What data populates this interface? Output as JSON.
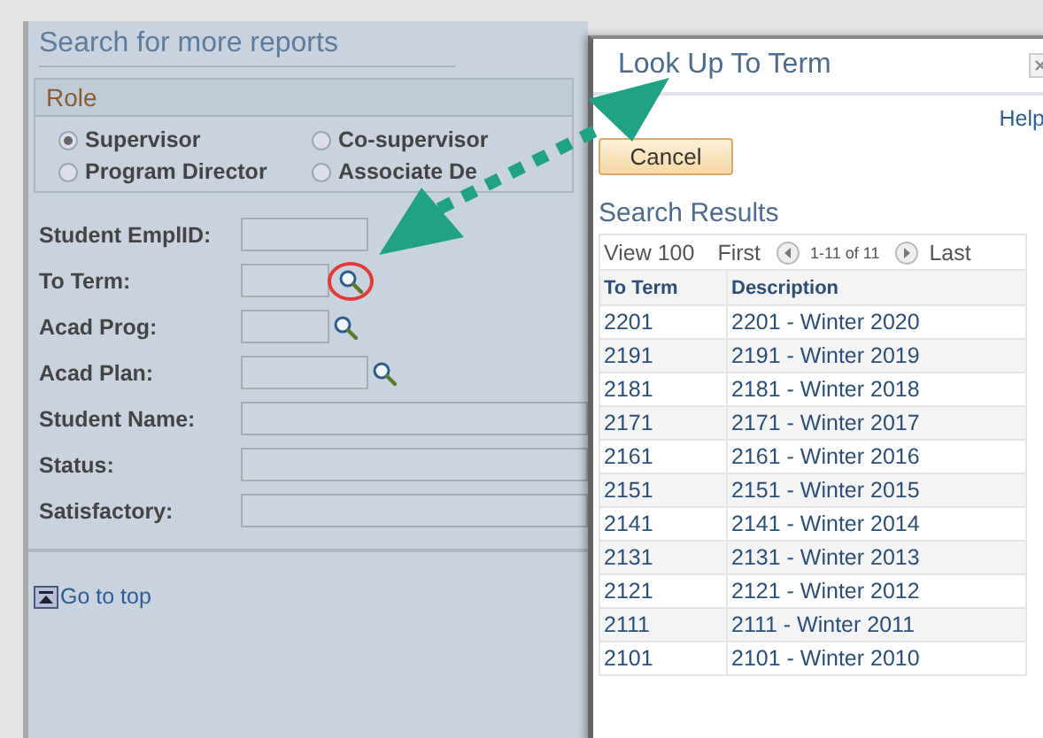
{
  "search_panel": {
    "title": "Search for more reports",
    "role": {
      "label": "Role",
      "options": [
        {
          "label": "Supervisor",
          "selected": true
        },
        {
          "label": "Co-supervisor",
          "selected": false
        },
        {
          "label": "Program Director",
          "selected": false
        },
        {
          "label": "Associate De",
          "selected": false
        }
      ]
    },
    "fields": [
      {
        "label": "Student EmplID:",
        "kind": "medium",
        "lookup": false,
        "highlighted": false
      },
      {
        "label": "To Term:",
        "kind": "short",
        "lookup": true,
        "highlighted": true
      },
      {
        "label": "Acad Prog:",
        "kind": "short",
        "lookup": true,
        "highlighted": false
      },
      {
        "label": "Acad Plan:",
        "kind": "medium",
        "lookup": true,
        "highlighted": false
      },
      {
        "label": "Student Name:",
        "kind": "long",
        "lookup": false,
        "highlighted": false
      },
      {
        "label": "Status:",
        "kind": "long",
        "lookup": false,
        "highlighted": false
      },
      {
        "label": "Satisfactory:",
        "kind": "long",
        "lookup": false,
        "highlighted": false
      }
    ],
    "go_to_top": "Go to top"
  },
  "lookup_dialog": {
    "title": "Look Up To Term",
    "help": "Help",
    "cancel": "Cancel",
    "results_title": "Search Results",
    "navigation": {
      "view": "View 100",
      "first": "First",
      "range": "1-11 of 11",
      "last": "Last"
    },
    "columns": [
      "To Term",
      "Description"
    ],
    "rows": [
      [
        "2201",
        "2201 - Winter 2020"
      ],
      [
        "2191",
        "2191 - Winter 2019"
      ],
      [
        "2181",
        "2181 - Winter 2018"
      ],
      [
        "2171",
        "2171 - Winter 2017"
      ],
      [
        "2161",
        "2161 - Winter 2016"
      ],
      [
        "2151",
        "2151 - Winter 2015"
      ],
      [
        "2141",
        "2141 - Winter 2014"
      ],
      [
        "2131",
        "2131 - Winter 2013"
      ],
      [
        "2121",
        "2121 - Winter 2012"
      ],
      [
        "2111",
        "2111 - Winter 2011"
      ],
      [
        "2101",
        "2101 - Winter 2010"
      ]
    ]
  }
}
